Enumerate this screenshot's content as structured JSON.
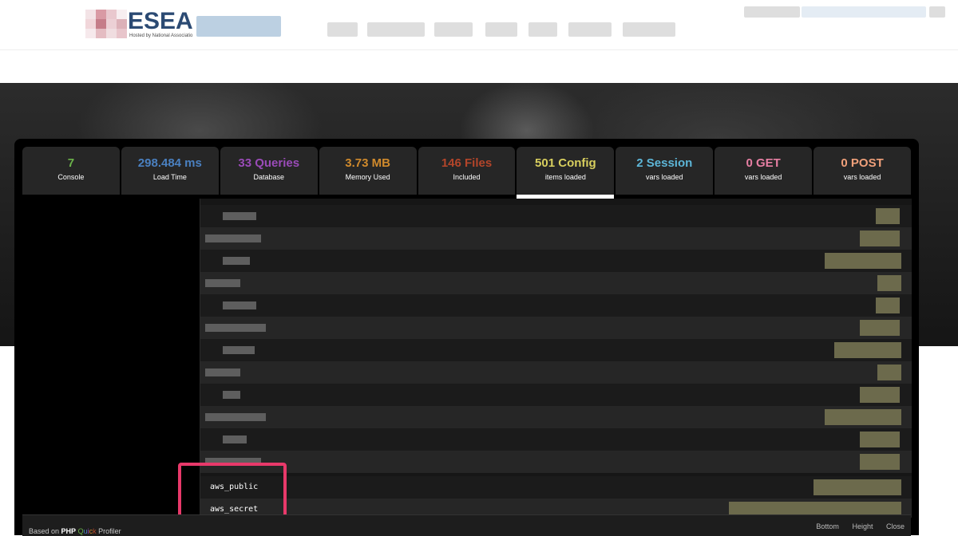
{
  "site": {
    "logo_text": "ESEA",
    "logo_sub": "Hosted by National Associatio"
  },
  "profiler": {
    "tabs": [
      {
        "value": "7",
        "label": "Console",
        "color": "#6bb34a"
      },
      {
        "value": "298.484 ms",
        "label": "Load Time",
        "color": "#4a80c0"
      },
      {
        "value": "33 Queries",
        "label": "Database",
        "color": "#9a4bb8"
      },
      {
        "value": "3.73 MB",
        "label": "Memory Used",
        "color": "#d08a2c"
      },
      {
        "value": "146 Files",
        "label": "Included",
        "color": "#b3452a"
      },
      {
        "value": "501 Config",
        "label": "items loaded",
        "color": "#d8cf5e",
        "active": true
      },
      {
        "value": "2 Session",
        "label": "vars loaded",
        "color": "#5db6d8"
      },
      {
        "value": "0 GET",
        "label": "vars loaded",
        "color": "#e77fa3"
      },
      {
        "value": "0 POST",
        "label": "vars loaded",
        "color": "#f0a07a"
      }
    ],
    "visible_keys": [
      "aws_public",
      "aws_secret"
    ],
    "footer": {
      "based_prefix": "Based on ",
      "php": "PHP",
      "quick": "Quick",
      "profiler": " Profiler",
      "links": [
        "Bottom",
        "Height",
        "Close"
      ]
    }
  }
}
